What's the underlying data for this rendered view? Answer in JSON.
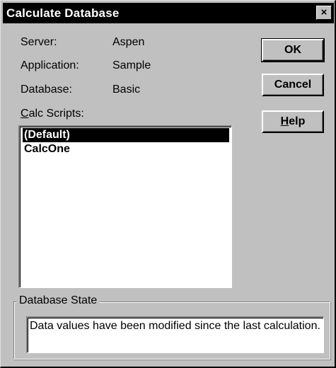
{
  "window": {
    "title": "Calculate Database",
    "close_glyph": "×"
  },
  "info": {
    "server_label": "Server:",
    "server_value": "Aspen",
    "application_label": "Application:",
    "application_value": "Sample",
    "database_label": "Database:",
    "database_value": "Basic"
  },
  "calc_scripts": {
    "label_mnemonic": "C",
    "label_rest": "alc Scripts:",
    "items": [
      "(Default)",
      "CalcOne"
    ],
    "selected_index": 0
  },
  "buttons": {
    "ok": "OK",
    "cancel": "Cancel",
    "help_mnemonic": "H",
    "help_rest": "elp"
  },
  "database_state": {
    "legend": "Database State",
    "text": "Data values have been modified since the last calculation."
  }
}
